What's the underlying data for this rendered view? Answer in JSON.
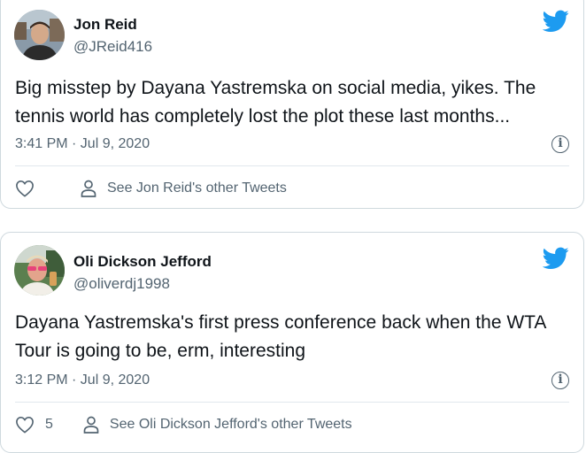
{
  "tweets": [
    {
      "name": "Jon Reid",
      "handle": "@JReid416",
      "text": "Big misstep by Dayana Yastremska on social media, yikes. The tennis world has completely lost the plot these last months...",
      "timestamp": "3:41 PM · Jul 9, 2020",
      "like_count": "",
      "see_tweets_label": "See Jon Reid's other Tweets"
    },
    {
      "name": "Oli Dickson Jefford",
      "handle": "@oliverdj1998",
      "text": "Dayana Yastremska's first press conference back when the WTA Tour is going to be, erm, interesting",
      "timestamp": "3:12 PM · Jul 9, 2020",
      "like_count": "5",
      "see_tweets_label": "See Oli Dickson Jefford's other Tweets"
    }
  ],
  "icons": {
    "brand": "twitter-bird-icon",
    "info": "info-icon",
    "like": "heart-icon",
    "profile": "person-icon"
  },
  "colors": {
    "twitter_blue": "#1d9bf0",
    "secondary_text": "#536471",
    "border": "#cfd9de"
  }
}
